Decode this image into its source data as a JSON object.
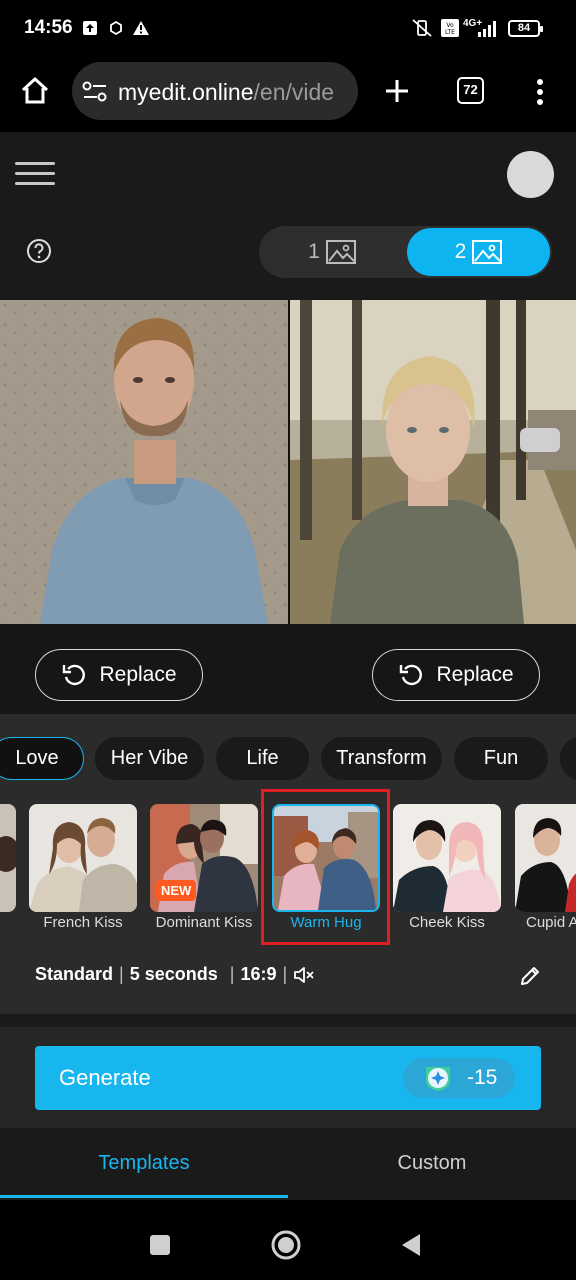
{
  "status_bar": {
    "time": "14:56",
    "battery": "84",
    "network": "4G+"
  },
  "browser": {
    "url_host": "myedit.online",
    "url_path": "/en/vide",
    "tab_count": "72"
  },
  "mode_toggle": {
    "option1": "1",
    "option2": "2",
    "selected": "2"
  },
  "replace": {
    "left_label": "Replace",
    "right_label": "Replace"
  },
  "categories": [
    {
      "label": "Love",
      "active": true
    },
    {
      "label": "Her Vibe",
      "active": false
    },
    {
      "label": "Life",
      "active": false
    },
    {
      "label": "Transform",
      "active": false
    },
    {
      "label": "Fun",
      "active": false
    }
  ],
  "templates": [
    {
      "label": "French Kiss"
    },
    {
      "label": "Dominant Kiss",
      "badge": "NEW"
    },
    {
      "label": "Warm Hug",
      "selected": true
    },
    {
      "label": "Cheek Kiss"
    },
    {
      "label": "Cupid A"
    }
  ],
  "settings": {
    "quality": "Standard",
    "duration": "5 seconds",
    "ratio": "16:9"
  },
  "generate": {
    "label": "Generate",
    "cost": "-15"
  },
  "tabs": {
    "templates": "Templates",
    "custom": "Custom",
    "active": "Templates"
  },
  "colors": {
    "accent": "#18b6ee",
    "highlight": "#e01e23",
    "new_badge": "#ff5a1f"
  }
}
